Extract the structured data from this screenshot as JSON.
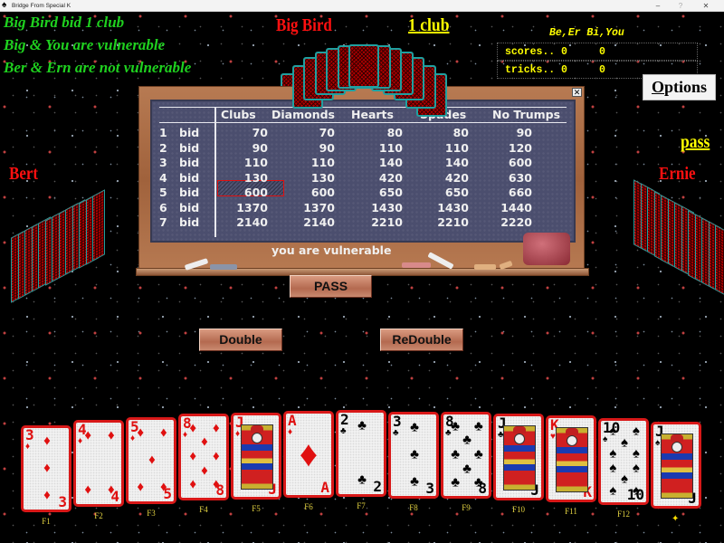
{
  "window": {
    "title": "Bridge From Special K",
    "controls": {
      "minimize": "–",
      "help": "?",
      "close": "✕"
    },
    "app_icon": "spade-icon"
  },
  "status_lines": [
    "Big Bird bid 1 club",
    "Big & You are vulnerable",
    "Ber & Ern are not vulnerable"
  ],
  "players": {
    "north": {
      "name": "Big Bird",
      "last_bid": "1 club",
      "cards_remaining": 13
    },
    "west": {
      "name": "Bert",
      "cards_remaining": 13
    },
    "east": {
      "name": "Ernie",
      "last_bid": "pass",
      "cards_remaining": 13
    }
  },
  "scoreboard": {
    "header": "Be,Er Bi,You",
    "rows": [
      {
        "label": "scores..",
        "team1": "0",
        "team2": "0"
      },
      {
        "label": "tricks..",
        "team1": "0",
        "team2": "0"
      }
    ]
  },
  "options_button": {
    "label_first": "O",
    "label_rest": "ptions"
  },
  "bid_table": {
    "close": "✕",
    "columns": [
      "Clubs",
      "Diamonds",
      "Hearts",
      "Spades",
      "No Trumps"
    ],
    "rows": [
      {
        "level": "1",
        "label": "bid",
        "values": [
          "70",
          "70",
          "80",
          "80",
          "90"
        ]
      },
      {
        "level": "2",
        "label": "bid",
        "values": [
          "90",
          "90",
          "110",
          "110",
          "120"
        ]
      },
      {
        "level": "3",
        "label": "bid",
        "values": [
          "110",
          "110",
          "140",
          "140",
          "600"
        ]
      },
      {
        "level": "4",
        "label": "bid",
        "values": [
          "130",
          "130",
          "420",
          "420",
          "630"
        ]
      },
      {
        "level": "5",
        "label": "bid",
        "values": [
          "600",
          "600",
          "650",
          "650",
          "660"
        ]
      },
      {
        "level": "6",
        "label": "bid",
        "values": [
          "1370",
          "1370",
          "1430",
          "1430",
          "1440"
        ]
      },
      {
        "level": "7",
        "label": "bid",
        "values": [
          "2140",
          "2140",
          "2210",
          "2210",
          "2220"
        ]
      }
    ],
    "selected": {
      "level": "4",
      "suit": "Clubs",
      "value": "130"
    },
    "note": "you are vulnerable"
  },
  "buttons": {
    "pass": "PASS",
    "double": "Double",
    "redouble": "ReDouble"
  },
  "hand": [
    {
      "rank": "3",
      "suit": "♦",
      "color": "red",
      "key": "F1"
    },
    {
      "rank": "4",
      "suit": "♦",
      "color": "red",
      "key": "F2"
    },
    {
      "rank": "5",
      "suit": "♦",
      "color": "red",
      "key": "F3"
    },
    {
      "rank": "8",
      "suit": "♦",
      "color": "red",
      "key": "F4"
    },
    {
      "rank": "J",
      "suit": "♦",
      "color": "red",
      "key": "F5",
      "face": true
    },
    {
      "rank": "A",
      "suit": "♦",
      "color": "red",
      "key": "F6"
    },
    {
      "rank": "2",
      "suit": "♣",
      "color": "black",
      "key": "F7"
    },
    {
      "rank": "3",
      "suit": "♣",
      "color": "black",
      "key": "F8"
    },
    {
      "rank": "8",
      "suit": "♣",
      "color": "black",
      "key": "F9"
    },
    {
      "rank": "J",
      "suit": "♣",
      "color": "black",
      "key": "F10",
      "face": true
    },
    {
      "rank": "K",
      "suit": "♥",
      "color": "red",
      "key": "F11",
      "face": true
    },
    {
      "rank": "10",
      "suit": "♠",
      "color": "black",
      "key": "F12"
    },
    {
      "rank": "J",
      "suit": "♠",
      "color": "black",
      "key": "",
      "face": true,
      "marker": "✦"
    }
  ]
}
